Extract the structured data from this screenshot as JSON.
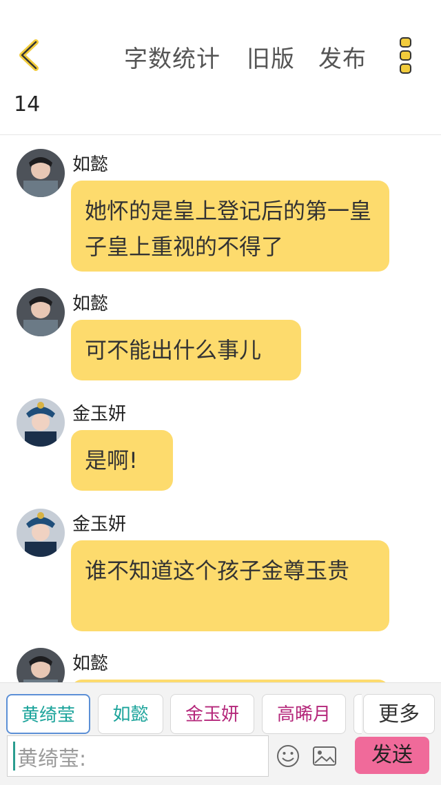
{
  "header": {
    "word_count_label": "字数统计",
    "old_version_label": "旧版",
    "publish_label": "发布",
    "count": "14"
  },
  "messages": [
    {
      "name": "如懿",
      "text": "她怀的是皇上登记后的第一皇子皇上重视的不得了"
    },
    {
      "name": "如懿",
      "text": "可不能出什么事儿"
    },
    {
      "name": "金玉妍",
      "text": "是啊!"
    },
    {
      "name": "金玉妍",
      "text": "谁不知道这个孩子金尊玉贵"
    },
    {
      "name": "如懿",
      "text": ""
    }
  ],
  "characters": [
    {
      "label": "黄绮莹",
      "color": "#1aa39a",
      "selected": true
    },
    {
      "label": "如懿",
      "color": "#1aa39a"
    },
    {
      "label": "金玉妍",
      "color": "#b4267a"
    },
    {
      "label": "高晞月",
      "color": "#b4267a"
    }
  ],
  "more_label": "更多",
  "input": {
    "placeholder": "黄绮莹:"
  },
  "send_label": "发送",
  "colors": {
    "accent": "#fddb6d",
    "send": "#f06a9a",
    "icon_yellow": "#f2cc3c"
  },
  "icons": [
    "back-chevron-icon",
    "more-menu-icon",
    "emoji-icon",
    "image-icon"
  ]
}
